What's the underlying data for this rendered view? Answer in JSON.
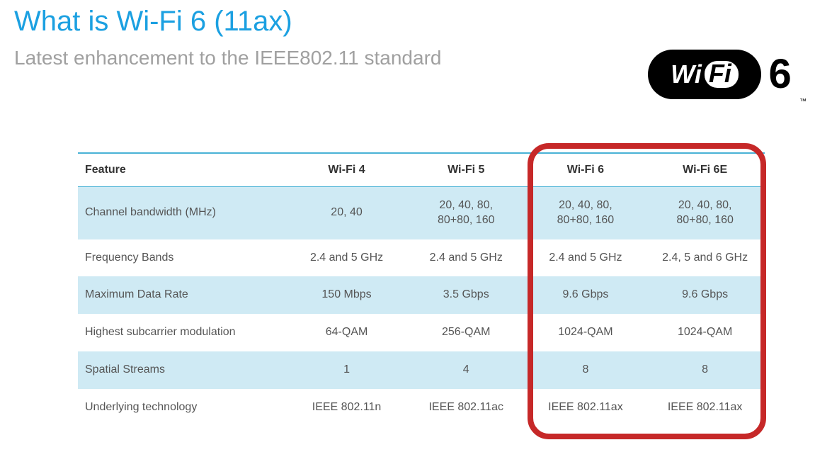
{
  "title": "What is Wi-Fi 6 (11ax)",
  "subtitle": "Latest enhancement to the IEEE802.11 standard",
  "logo": {
    "wi": "Wi",
    "fi": "Fi",
    "six": "6",
    "tm": "™"
  },
  "table": {
    "headers": [
      "Feature",
      "Wi-Fi 4",
      "Wi-Fi 5",
      "Wi-Fi 6",
      "Wi-Fi 6E"
    ],
    "rows": [
      {
        "shade": true,
        "feature": "Channel bandwidth (MHz)",
        "cells": [
          "20, 40",
          "20, 40, 80,\n80+80, 160",
          "20, 40, 80,\n80+80, 160",
          "20, 40, 80,\n80+80, 160"
        ]
      },
      {
        "shade": false,
        "feature": "Frequency Bands",
        "cells": [
          "2.4 and 5 GHz",
          "2.4 and 5 GHz",
          "2.4 and 5 GHz",
          "2.4, 5 and 6 GHz"
        ]
      },
      {
        "shade": true,
        "feature": "Maximum Data Rate",
        "cells": [
          "150 Mbps",
          "3.5 Gbps",
          "9.6 Gbps",
          "9.6 Gbps"
        ]
      },
      {
        "shade": false,
        "feature": "Highest subcarrier modulation",
        "cells": [
          "64-QAM",
          "256-QAM",
          "1024-QAM",
          "1024-QAM"
        ]
      },
      {
        "shade": true,
        "feature": "Spatial Streams",
        "cells": [
          "1",
          "4",
          "8",
          "8"
        ]
      },
      {
        "shade": false,
        "feature": "Underlying technology",
        "cells": [
          "IEEE 802.11n",
          "IEEE 802.11ac",
          "IEEE 802.11ax",
          "IEEE 802.11ax"
        ]
      }
    ]
  },
  "chart_data": {
    "type": "table",
    "title": "Wi-Fi generations comparison",
    "columns": [
      "Feature",
      "Wi-Fi 4",
      "Wi-Fi 5",
      "Wi-Fi 6",
      "Wi-Fi 6E"
    ],
    "rows": [
      [
        "Channel bandwidth (MHz)",
        "20, 40",
        "20, 40, 80, 80+80, 160",
        "20, 40, 80, 80+80, 160",
        "20, 40, 80, 80+80, 160"
      ],
      [
        "Frequency Bands",
        "2.4 and 5 GHz",
        "2.4 and 5 GHz",
        "2.4 and 5 GHz",
        "2.4, 5 and 6 GHz"
      ],
      [
        "Maximum Data Rate",
        "150 Mbps",
        "3.5 Gbps",
        "9.6 Gbps",
        "9.6 Gbps"
      ],
      [
        "Highest subcarrier modulation",
        "64-QAM",
        "256-QAM",
        "1024-QAM",
        "1024-QAM"
      ],
      [
        "Spatial Streams",
        "1",
        "4",
        "8",
        "8"
      ],
      [
        "Underlying technology",
        "IEEE 802.11n",
        "IEEE 802.11ac",
        "IEEE 802.11ax",
        "IEEE 802.11ax"
      ]
    ],
    "highlighted_columns": [
      "Wi-Fi 6",
      "Wi-Fi 6E"
    ]
  }
}
